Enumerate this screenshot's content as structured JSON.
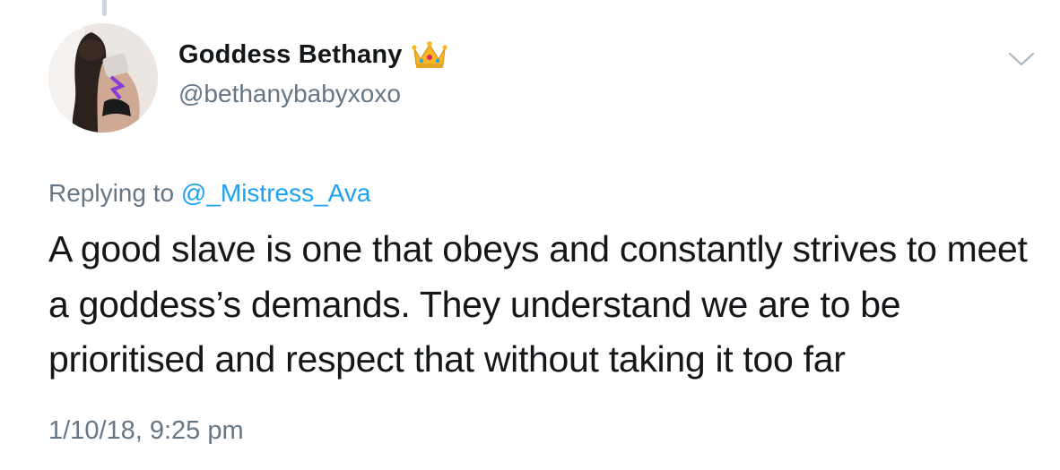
{
  "tweet": {
    "display_name": "Goddess Bethany",
    "badge_icon": "crown-icon",
    "handle": "@bethanybabyxoxo",
    "replying_prefix": "Replying to",
    "replying_to": "@_Mistress_Ava",
    "text": "A good slave is one that obeys and constantly strives to meet a goddess’s demands. They understand we are to be prioritised and respect that without taking it too far",
    "timestamp": "1/10/18, 9:25 pm",
    "menu_icon": "chevron-down-icon"
  },
  "colors": {
    "text_primary": "#14171a",
    "text_secondary": "#657786",
    "link": "#1da1f2",
    "thread_line": "#ccd6dd",
    "background": "#ffffff"
  }
}
